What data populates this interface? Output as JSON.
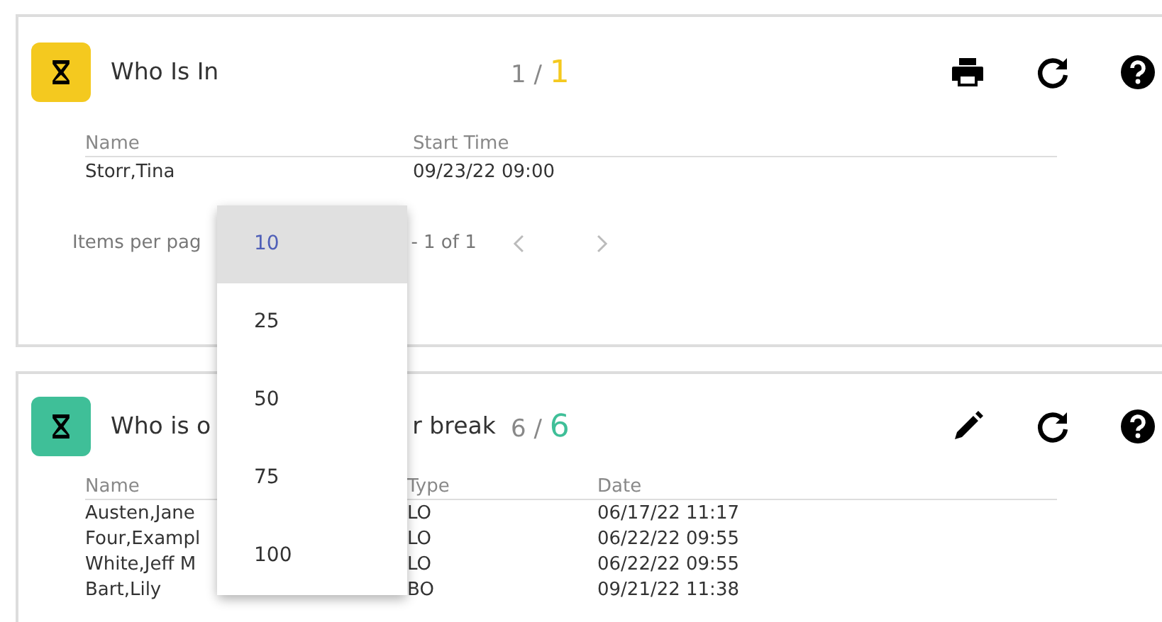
{
  "cards": [
    {
      "color": "#f4c91f",
      "title_parts": [
        "Who Is In"
      ],
      "count": "1",
      "separator": "/",
      "total": "1",
      "actions": [
        {
          "kind": "print"
        },
        {
          "kind": "refresh"
        },
        {
          "kind": "help"
        }
      ],
      "columns": [
        "Name",
        "Start Time"
      ],
      "rows": [
        [
          "Storr,Tina",
          "09/23/22 09:00"
        ]
      ],
      "pager": {
        "label": "Items per pag",
        "range": "- 1 of 1",
        "prev_disabled": true,
        "next_disabled": true
      }
    },
    {
      "color": "#3fbf98",
      "title_parts": [
        "Who is o",
        "r break"
      ],
      "count": "6",
      "separator": "/",
      "total": "6",
      "actions": [
        {
          "kind": "edit"
        },
        {
          "kind": "refresh"
        },
        {
          "kind": "help"
        }
      ],
      "columns": [
        "Name",
        "Type",
        "Date"
      ],
      "rows": [
        [
          "Austen,Jane",
          "LO",
          "06/17/22 11:17"
        ],
        [
          "Four,Exampl",
          "LO",
          "06/22/22 09:55"
        ],
        [
          "White,Jeff M",
          "LO",
          "06/22/22 09:55"
        ],
        [
          "Bart,Lily",
          "BO",
          "09/21/22 11:38"
        ]
      ]
    }
  ],
  "dropdown": {
    "options": [
      {
        "label": "10",
        "selected": true
      },
      {
        "label": "25",
        "selected": false
      },
      {
        "label": "50",
        "selected": false
      },
      {
        "label": "75",
        "selected": false
      },
      {
        "label": "100",
        "selected": false
      }
    ]
  }
}
